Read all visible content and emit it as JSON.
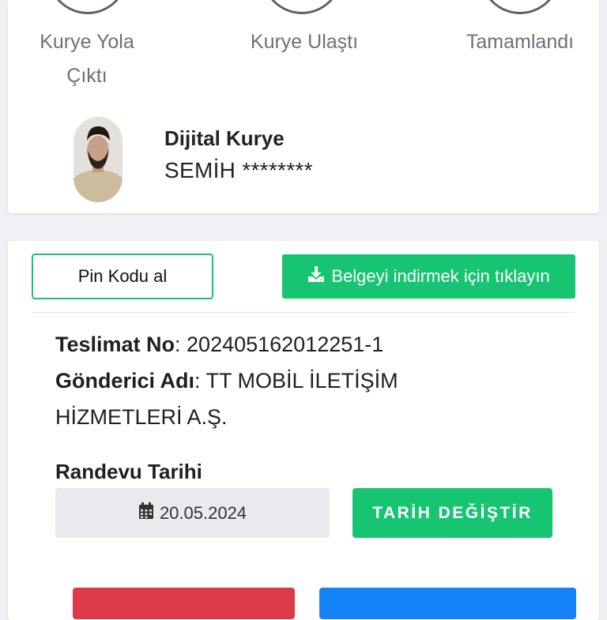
{
  "status_steps": [
    {
      "label_line1": "Kurye Yola",
      "label_line2": "Çıktı"
    },
    {
      "label_line1": "Kurye Ulaştı",
      "label_line2": ""
    },
    {
      "label_line1": "Tamamlandı",
      "label_line2": ""
    }
  ],
  "courier": {
    "title": "Dijital Kurye",
    "name": "SEMİH ********"
  },
  "actions": {
    "pin_label": "Pin Kodu al",
    "download_label": "Belgeyi indirmek için tıklayın",
    "download_icon": "download-icon"
  },
  "delivery": {
    "no_label": "Teslimat No",
    "no_value": ": 202405162012251-1",
    "sender_label": "Gönderici Adı",
    "sender_value_line1": ": TT MOBİL İLETİŞİM",
    "sender_value_line2": "HİZMETLERİ A.Ş."
  },
  "appointment": {
    "label": "Randevu Tarihi",
    "date": "20.05.2024",
    "date_icon": "calendar-icon",
    "change_label": "TARİH DEĞİŞTİR"
  },
  "colors": {
    "accent_green": "#17c471",
    "danger_red": "#de3b4a",
    "primary_blue": "#1483f6"
  }
}
